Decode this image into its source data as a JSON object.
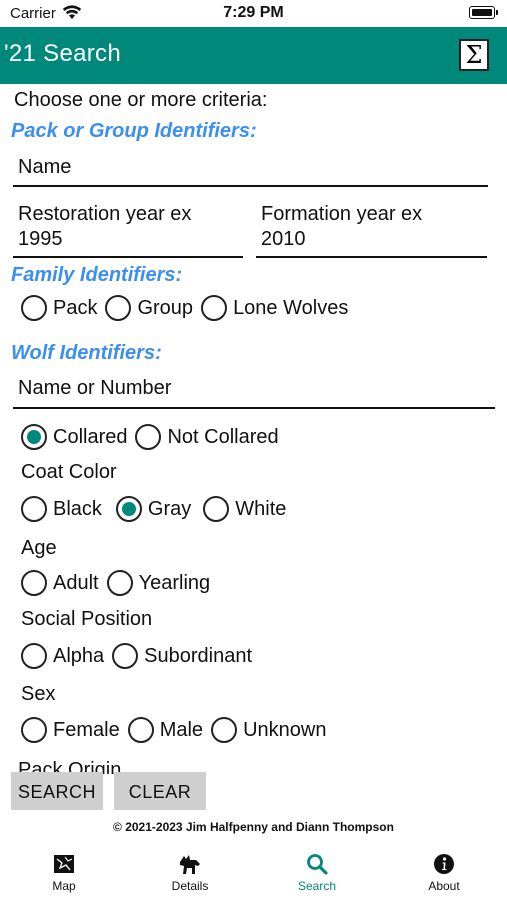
{
  "status": {
    "carrier": "Carrier",
    "time": "7:29 PM"
  },
  "header": {
    "title": "'21 Search",
    "sigma": "Σ"
  },
  "intro": "Choose one or more criteria:",
  "pack_section": {
    "title": "Pack or Group Identifiers:",
    "name_placeholder": "Name",
    "restoration_placeholder": "Restoration year ex 1995",
    "formation_placeholder": "Formation year ex 2010"
  },
  "family_section": {
    "title": "Family Identifiers:",
    "options": [
      "Pack",
      "Group",
      "Lone Wolves"
    ]
  },
  "wolf_section": {
    "title": "Wolf Identifiers:",
    "name_placeholder": "Name or Number",
    "collar_options": [
      "Collared",
      "Not Collared"
    ],
    "collar_selected": "Collared",
    "coat_label": "Coat Color",
    "coat_options": [
      "Black",
      "Gray",
      "White"
    ],
    "coat_selected": "Gray",
    "age_label": "Age",
    "age_options": [
      "Adult",
      "Yearling"
    ],
    "social_label": "Social Position",
    "social_options": [
      "Alpha",
      "Subordinant"
    ],
    "sex_label": "Sex",
    "sex_options": [
      "Female",
      "Male",
      "Unknown"
    ],
    "cut_label": "Pack Origin"
  },
  "buttons": {
    "search": "SEARCH",
    "clear": "CLEAR"
  },
  "copyright": "© 2021-2023 Jim Halfpenny and Diann Thompson",
  "tabs": [
    {
      "label": "Map",
      "icon": "map-icon"
    },
    {
      "label": "Details",
      "icon": "wolf-icon"
    },
    {
      "label": "Search",
      "icon": "search-icon"
    },
    {
      "label": "About",
      "icon": "info-icon"
    }
  ],
  "colors": {
    "accent": "#00897b",
    "section": "#3b8ff0",
    "button": "#cfcfcf"
  }
}
